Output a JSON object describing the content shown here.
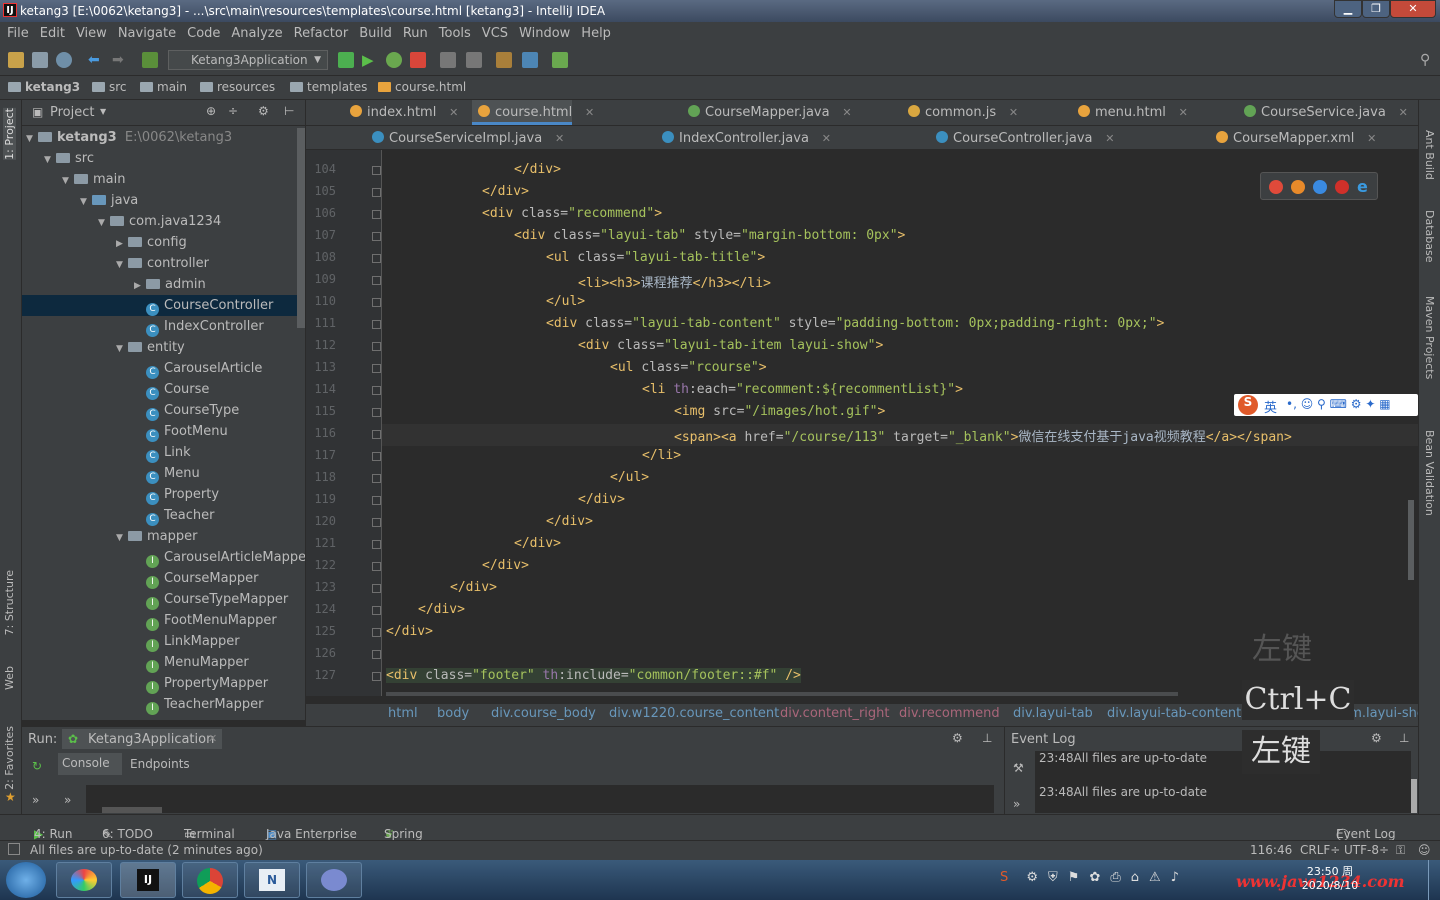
{
  "window": {
    "title": "ketang3 [E:\\0062\\ketang3] - ...\\src\\main\\resources\\templates\\course.html [ketang3] - IntelliJ IDEA",
    "logo": "IJ"
  },
  "menu": [
    "File",
    "Edit",
    "View",
    "Navigate",
    "Code",
    "Analyze",
    "Refactor",
    "Build",
    "Run",
    "Tools",
    "VCS",
    "Window",
    "Help"
  ],
  "toolbar": {
    "run_config": "Ketang3Application"
  },
  "nav": [
    "ketang3",
    "src",
    "main",
    "resources",
    "templates",
    "course.html"
  ],
  "left_strip": [
    "1: Project",
    "7: Structure",
    "Web",
    "2: Favorites"
  ],
  "project": {
    "title": "Project",
    "root_name": "ketang3",
    "root_path": "E:\\0062\\ketang3",
    "tree": [
      {
        "label": "src",
        "depth": 1,
        "kind": "folder",
        "arrow": "▼"
      },
      {
        "label": "main",
        "depth": 2,
        "kind": "folder",
        "arrow": "▼"
      },
      {
        "label": "java",
        "depth": 3,
        "kind": "folder-blue",
        "arrow": "▼"
      },
      {
        "label": "com.java1234",
        "depth": 4,
        "kind": "folder",
        "arrow": "▼"
      },
      {
        "label": "config",
        "depth": 5,
        "kind": "folder",
        "arrow": "▶"
      },
      {
        "label": "controller",
        "depth": 5,
        "kind": "folder",
        "arrow": "▼"
      },
      {
        "label": "admin",
        "depth": 6,
        "kind": "folder",
        "arrow": "▶"
      },
      {
        "label": "CourseController",
        "depth": 6,
        "kind": "class",
        "arrow": "",
        "selected": true
      },
      {
        "label": "IndexController",
        "depth": 6,
        "kind": "class",
        "arrow": ""
      },
      {
        "label": "entity",
        "depth": 5,
        "kind": "folder",
        "arrow": "▼"
      },
      {
        "label": "CarouselArticle",
        "depth": 6,
        "kind": "class",
        "arrow": ""
      },
      {
        "label": "Course",
        "depth": 6,
        "kind": "class",
        "arrow": ""
      },
      {
        "label": "CourseType",
        "depth": 6,
        "kind": "class",
        "arrow": ""
      },
      {
        "label": "FootMenu",
        "depth": 6,
        "kind": "class",
        "arrow": ""
      },
      {
        "label": "Link",
        "depth": 6,
        "kind": "class",
        "arrow": ""
      },
      {
        "label": "Menu",
        "depth": 6,
        "kind": "class",
        "arrow": ""
      },
      {
        "label": "Property",
        "depth": 6,
        "kind": "class",
        "arrow": ""
      },
      {
        "label": "Teacher",
        "depth": 6,
        "kind": "class",
        "arrow": ""
      },
      {
        "label": "mapper",
        "depth": 5,
        "kind": "folder",
        "arrow": "▼"
      },
      {
        "label": "CarouselArticleMapper",
        "depth": 6,
        "kind": "interface",
        "arrow": ""
      },
      {
        "label": "CourseMapper",
        "depth": 6,
        "kind": "interface",
        "arrow": ""
      },
      {
        "label": "CourseTypeMapper",
        "depth": 6,
        "kind": "interface",
        "arrow": ""
      },
      {
        "label": "FootMenuMapper",
        "depth": 6,
        "kind": "interface",
        "arrow": ""
      },
      {
        "label": "LinkMapper",
        "depth": 6,
        "kind": "interface",
        "arrow": ""
      },
      {
        "label": "MenuMapper",
        "depth": 6,
        "kind": "interface",
        "arrow": ""
      },
      {
        "label": "PropertyMapper",
        "depth": 6,
        "kind": "interface",
        "arrow": ""
      },
      {
        "label": "TeacherMapper",
        "depth": 6,
        "kind": "interface",
        "arrow": ""
      }
    ]
  },
  "tabs_row1": [
    {
      "label": "index.html",
      "color": "#e8a33d"
    },
    {
      "label": "course.html",
      "color": "#e8a33d",
      "active": true
    },
    {
      "label": "CourseMapper.java",
      "color": "#62a355"
    },
    {
      "label": "common.js",
      "color": "#d9a740"
    },
    {
      "label": "menu.html",
      "color": "#e8a33d"
    },
    {
      "label": "CourseService.java",
      "color": "#62a355"
    }
  ],
  "tabs_row2": [
    {
      "label": "CourseServiceImpl.java",
      "color": "#3b8fbf"
    },
    {
      "label": "IndexController.java",
      "color": "#3b8fbf"
    },
    {
      "label": "CourseController.java",
      "color": "#3b8fbf"
    },
    {
      "label": "CourseMapper.xml",
      "color": "#e8a33d"
    }
  ],
  "code_lines": [
    {
      "n": "104",
      "indent": 16,
      "html": "<span class=\"tg\">&lt;/div&gt;</span>"
    },
    {
      "n": "105",
      "indent": 12,
      "html": "<span class=\"tg\">&lt;/div&gt;</span>"
    },
    {
      "n": "106",
      "indent": 12,
      "html": "<span class=\"tg\">&lt;div </span><span class=\"at\">class=</span><span class=\"sv\">\"recommend\"</span><span class=\"tg\">&gt;</span>"
    },
    {
      "n": "107",
      "indent": 16,
      "html": "<span class=\"tg\">&lt;div </span><span class=\"at\">class=</span><span class=\"sv\">\"layui-tab\"</span><span class=\"at\"> style=</span><span class=\"sv\">\"margin-bottom: 0px\"</span><span class=\"tg\">&gt;</span>"
    },
    {
      "n": "108",
      "indent": 20,
      "html": "<span class=\"tg\">&lt;ul </span><span class=\"at\">class=</span><span class=\"sv\">\"layui-tab-title\"</span><span class=\"tg\">&gt;</span>"
    },
    {
      "n": "109",
      "indent": 24,
      "html": "<span class=\"tg\">&lt;li&gt;&lt;h3&gt;</span>课程推荐<span class=\"tg\">&lt;/h3&gt;&lt;/li&gt;</span>"
    },
    {
      "n": "110",
      "indent": 20,
      "html": "<span class=\"tg\">&lt;/ul&gt;</span>"
    },
    {
      "n": "111",
      "indent": 20,
      "html": "<span class=\"tg\">&lt;div </span><span class=\"at\">class=</span><span class=\"sv\">\"layui-tab-content\"</span><span class=\"at\"> style=</span><span class=\"sv\">\"padding-bottom: 0px;padding-right: 0px;\"</span><span class=\"tg\">&gt;</span>"
    },
    {
      "n": "112",
      "indent": 24,
      "html": "<span class=\"tg\">&lt;div </span><span class=\"at\">class=</span><span class=\"sv\">\"layui-tab-item layui-show\"</span><span class=\"tg\">&gt;</span>"
    },
    {
      "n": "113",
      "indent": 28,
      "html": "<span class=\"tg\">&lt;ul </span><span class=\"at\">class=</span><span class=\"sv\">\"rcourse\"</span><span class=\"tg\">&gt;</span>"
    },
    {
      "n": "114",
      "indent": 32,
      "html": "<span class=\"tg\">&lt;li </span><span class=\"th\">th</span><span class=\"at\">:each=</span><span class=\"sv\">\"recomment:${recommentList}\"</span><span class=\"tg\">&gt;</span>"
    },
    {
      "n": "115",
      "indent": 36,
      "html": "<span class=\"tg\">&lt;img </span><span class=\"at\">src=</span><span class=\"sv\">\"/images/hot.gif\"</span><span class=\"tg\">&gt;</span>"
    },
    {
      "n": "116",
      "indent": 36,
      "html": "<span class=\"tg\">&lt;span&gt;&lt;a </span><span class=\"at\">href=</span><span class=\"sv\">\"/course/113\"</span><span class=\"at\"> target=</span><span class=\"sv\">\"_blank\"</span><span class=\"tg\">&gt;</span>微信在线支付基于java视频教程<span class=\"tg\">&lt;/a&gt;&lt;/span&gt;</span>"
    },
    {
      "n": "117",
      "indent": 32,
      "html": "<span class=\"tg\">&lt;/li&gt;</span>"
    },
    {
      "n": "118",
      "indent": 28,
      "html": "<span class=\"tg\">&lt;/ul&gt;</span>"
    },
    {
      "n": "119",
      "indent": 24,
      "html": "<span class=\"tg\">&lt;/div&gt;</span>"
    },
    {
      "n": "120",
      "indent": 20,
      "html": "<span class=\"tg\">&lt;/div&gt;</span>"
    },
    {
      "n": "121",
      "indent": 16,
      "html": "<span class=\"tg\">&lt;/div&gt;</span>"
    },
    {
      "n": "122",
      "indent": 12,
      "html": "<span class=\"tg\">&lt;/div&gt;</span>"
    },
    {
      "n": "123",
      "indent": 8,
      "html": "<span class=\"tg\">&lt;/div&gt;</span>"
    },
    {
      "n": "124",
      "indent": 4,
      "html": "<span class=\"tg\">&lt;/div&gt;</span>"
    },
    {
      "n": "125",
      "indent": 0,
      "html": "<span class=\"tg\">&lt;/div&gt;</span>"
    },
    {
      "n": "126",
      "indent": 0,
      "html": ""
    },
    {
      "n": "127",
      "indent": 0,
      "html": "<span class=\"hl\"><span class=\"tg\">&lt;div </span><span class=\"at\">class=</span><span class=\"sv\">\"footer\"</span><span class=\"th\"> th</span><span class=\"at\">:include=</span><span class=\"sv\">\"common/footer::#f\"</span><span class=\"tg\"> /&gt;</span></span>"
    }
  ],
  "code_breadcrumb": [
    "html",
    "body",
    "div.course_body",
    "div.w1220.course_content",
    "div.content_right",
    "div.recommend",
    "div.layui-tab",
    "div.layui-tab-content",
    "div.layui-tab-item.layui-show"
  ],
  "right_strip": [
    "Ant Build",
    "Database",
    "Maven Projects",
    "Bean Validation"
  ],
  "run_panel": {
    "label": "Run:",
    "config": "Ketang3Application",
    "console": "Console",
    "endpoints": "Endpoints"
  },
  "event_log": {
    "title": "Event Log",
    "entries": [
      {
        "time": "23:48",
        "text": "All files are up-to-date"
      },
      {
        "time": "23:48",
        "text": "All files are up-to-date"
      }
    ]
  },
  "tool_windows": [
    "4: Run",
    "6: TODO",
    "Terminal",
    "Java Enterprise",
    "Spring"
  ],
  "tool_windows_right": "Event Log",
  "status": {
    "message": "All files are up-to-date (2 minutes ago)",
    "position": "116:46",
    "line_sep": "CRLF÷",
    "encoding": "UTF-8÷"
  },
  "overlay": {
    "k1": "左键",
    "k2": "Ctrl+C",
    "k3": "左键"
  },
  "ime": {
    "lang": "英"
  },
  "clock": {
    "time": "23:50 周",
    "date": "2020/8/10"
  },
  "watermark": "www.java1234.com"
}
